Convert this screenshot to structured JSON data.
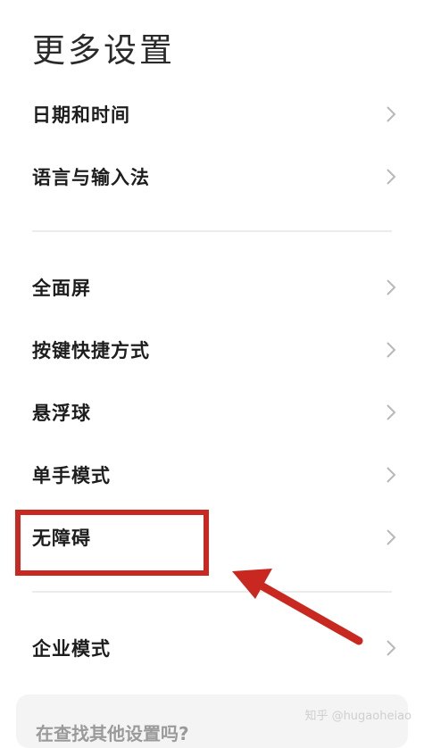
{
  "page_title": "更多设置",
  "group1": [
    {
      "label": "日期和时间"
    },
    {
      "label": "语言与输入法"
    }
  ],
  "group2": [
    {
      "label": "全面屏"
    },
    {
      "label": "按键快捷方式"
    },
    {
      "label": "悬浮球"
    },
    {
      "label": "单手模式"
    },
    {
      "label": "无障碍"
    }
  ],
  "group3": [
    {
      "label": "企业模式"
    }
  ],
  "bottom_prompt": "在查找其他设置吗?",
  "watermark": "知乎 @hugaoheiao",
  "colors": {
    "annotation_red": "#c8281f",
    "chevron": "#b8b8b8"
  },
  "icons": {
    "row_chevron": "chevron-right-icon"
  }
}
